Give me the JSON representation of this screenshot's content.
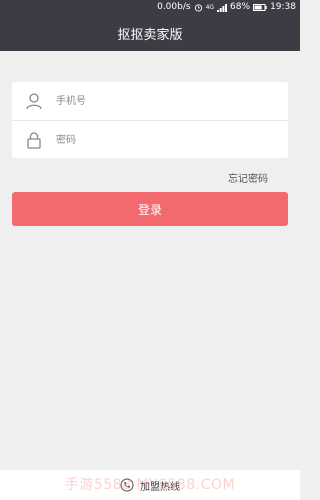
{
  "status_bar": {
    "speed": "0.00b/s",
    "network": "4G",
    "battery": "68%",
    "time": "19:38",
    "icons": [
      "alarm-icon",
      "signal-icon",
      "battery-icon"
    ]
  },
  "header": {
    "title": "抠抠卖家版"
  },
  "form": {
    "phone_placeholder": "手机号",
    "password_placeholder": "密码",
    "icons": [
      "user-icon",
      "lock-icon"
    ]
  },
  "links": {
    "forgot_password": "忘记密码"
  },
  "actions": {
    "login_label": "登录"
  },
  "footer": {
    "hotline_label": "加盟热线",
    "watermark": "手游5588 MYS588.COM",
    "icons": [
      "phone-icon"
    ]
  },
  "colors": {
    "header_bg": "#3c3c44",
    "page_bg": "#efefef",
    "login_button": "#f26a6e"
  }
}
